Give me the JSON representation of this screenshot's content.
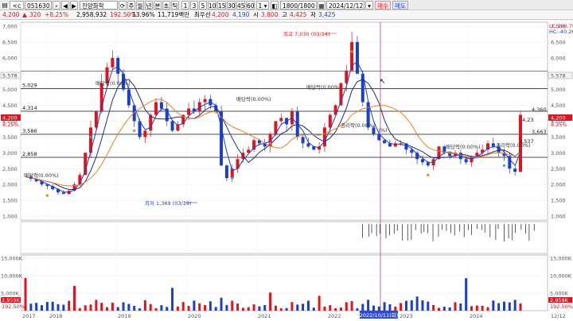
{
  "toolbar": {
    "code_label": "<c",
    "code_value": "051630",
    "name": "진양화학",
    "period_tabs": [
      "주",
      "월",
      "년",
      "분",
      "초",
      "틱"
    ],
    "minute_options": [
      "1",
      "3",
      "5",
      "10",
      "15",
      "30",
      "45",
      "60"
    ],
    "count_value": "1800/1800",
    "date_value": "2024/12/12",
    "buy_label": "매수",
    "sell_label": "매도"
  },
  "info": {
    "price": "4,200",
    "change": "320",
    "change_rate": "+8.25%",
    "volume": "2,958,932",
    "volume_ratio": "192.50%",
    "turnover": "13.96%",
    "amount": "11,719백만",
    "best_bid_label": "최우선",
    "best_bid": "4,200",
    "best_ask": "4,190",
    "open_label": "시",
    "open": "3,800",
    "high_label": "고",
    "high": "4,425",
    "low_label": "저",
    "low": "3,425"
  },
  "legend": {
    "lc": "LC:206.79",
    "hc": "HC:-40.26"
  },
  "colors": {
    "up": "#e0141e",
    "down": "#1c3fc8",
    "ma_short": "#1c3fc8",
    "ma_mid": "#222a8a",
    "ma_long": "#e8821e",
    "cursor": "#b03060",
    "levels": "#111111"
  },
  "annotations": {
    "high": "최고 7,030 (03/14)",
    "low": "최저 1,369 (03/19)",
    "dividends": [
      "배당락(0.00%)",
      "배당락(0.00%)",
      "배당락(0.00%)",
      "배당락(0.00%)",
      "권리락(0.00%)",
      "배당락(0.00%)",
      "권리락(0.00%)"
    ],
    "dividend_suffix": "%)",
    "cursor_date": "2022/10/11(화)"
  },
  "price_tags": {
    "current": "4,200",
    "current_rate": "8.25%",
    "left_level": "5.578",
    "right_level": "5.578",
    "right_rate": "8.25%",
    "right_tag_a": "4,360",
    "right_tag_b": "4,23",
    "right_tag_c": "3,663",
    "right_tag_d": "3,537"
  },
  "chart_data": {
    "type": "candlestick",
    "x_tick_labels": [
      "2017",
      "2018",
      "2019",
      "2020",
      "2021",
      "2022",
      "2023",
      "2024",
      "12/12"
    ],
    "price_axis": {
      "range": [
        1000,
        7000
      ],
      "tick_labels": [
        "7,000",
        "6,500",
        "6,000",
        "5,500",
        "5,000",
        "4,500",
        "4,000",
        "3,500",
        "3,000",
        "2,500",
        "2,000",
        "1,500",
        "1,000"
      ]
    },
    "volume_axis": {
      "range": [
        0,
        15000
      ],
      "tick_labels": [
        "15,000K",
        "10,000K",
        "5,000K"
      ],
      "tag_left_a": "2,959K",
      "tag_left_b": "192.50%",
      "tag_right_a": "2,959K",
      "tag_right_b": "192.50%"
    },
    "levels": [
      {
        "label": "5,029",
        "value": 5029
      },
      {
        "label": "4,314",
        "value": 4314
      },
      {
        "label": "3,586",
        "value": 3586
      },
      {
        "label": "2,858",
        "value": 2858
      }
    ],
    "reference_line": 5578,
    "highest": {
      "value": 7030,
      "date": "03/14"
    },
    "lowest": {
      "value": 1369,
      "date": "03/19"
    },
    "closes": [
      2250,
      2180,
      2100,
      2000,
      1950,
      1850,
      1750,
      1700,
      1800,
      2000,
      2300,
      3000,
      3800,
      4300,
      5200,
      5700,
      6000,
      5500,
      5000,
      4500,
      4000,
      3500,
      3700,
      4200,
      4600,
      4400,
      4000,
      3700,
      3900,
      4200,
      4400,
      4300,
      4600,
      4700,
      4500,
      4300,
      2600,
      2200,
      2500,
      2800,
      3000,
      3100,
      3400,
      3300,
      3200,
      3600,
      4000,
      4100,
      3900,
      4300,
      3500,
      3300,
      3200,
      3100,
      3200,
      3800,
      4200,
      4500,
      5200,
      5600,
      6500,
      5500,
      4600,
      3800,
      3600,
      3400,
      3300,
      3200,
      3300,
      3300,
      3100,
      3000,
      2800,
      2700,
      2600,
      2800,
      3200,
      3000,
      2900,
      3000,
      2800,
      2700,
      2900,
      3000,
      3100,
      3300,
      3200,
      3000,
      2900,
      2500,
      2400,
      4200
    ]
  }
}
